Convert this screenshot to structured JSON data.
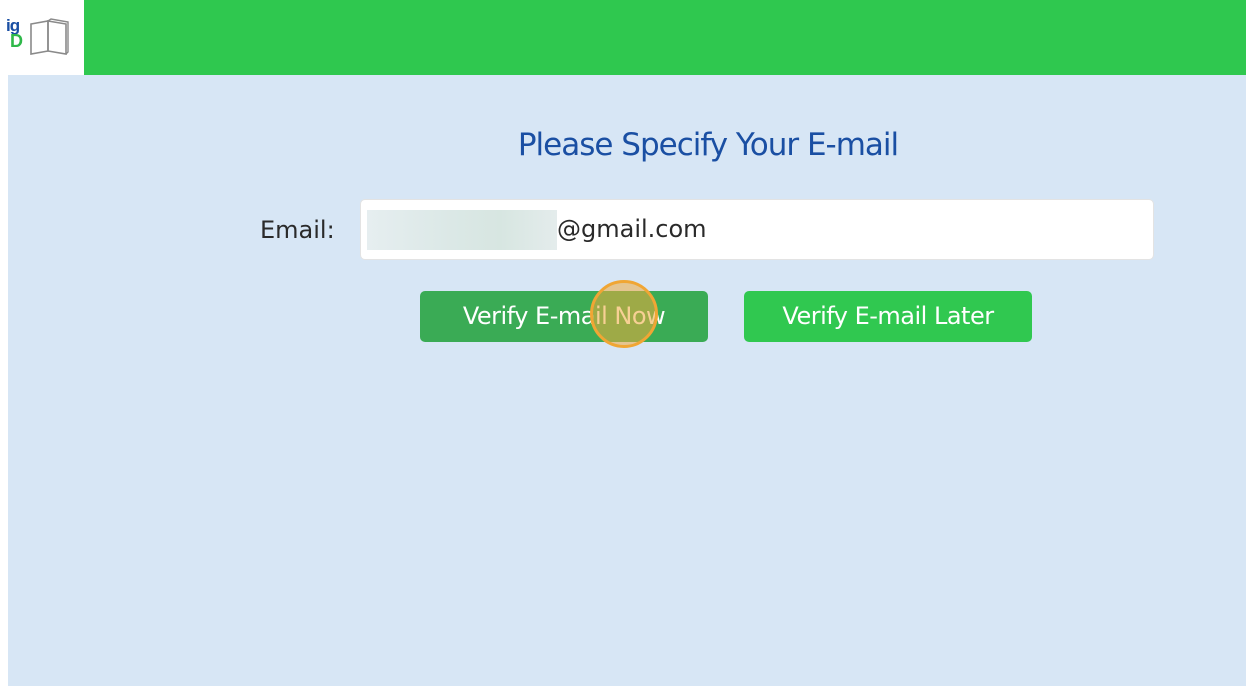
{
  "header": {
    "logo_text_top": "ig",
    "logo_text_bottom": "D",
    "bar_color": "#2fc84f"
  },
  "form": {
    "title": "Please Specify Your E-mail",
    "email_label": "Email:",
    "email_value": "@gmail.com"
  },
  "buttons": {
    "verify_now_label": "Verify E-mail Now",
    "verify_later_label": "Verify E-mail Later"
  },
  "colors": {
    "accent_green": "#30c850",
    "title_blue": "#1a4fa3",
    "content_background": "#d7e6f5"
  },
  "icons": {
    "logo_book": "open-book-icon",
    "click_indicator": "click-indicator"
  }
}
